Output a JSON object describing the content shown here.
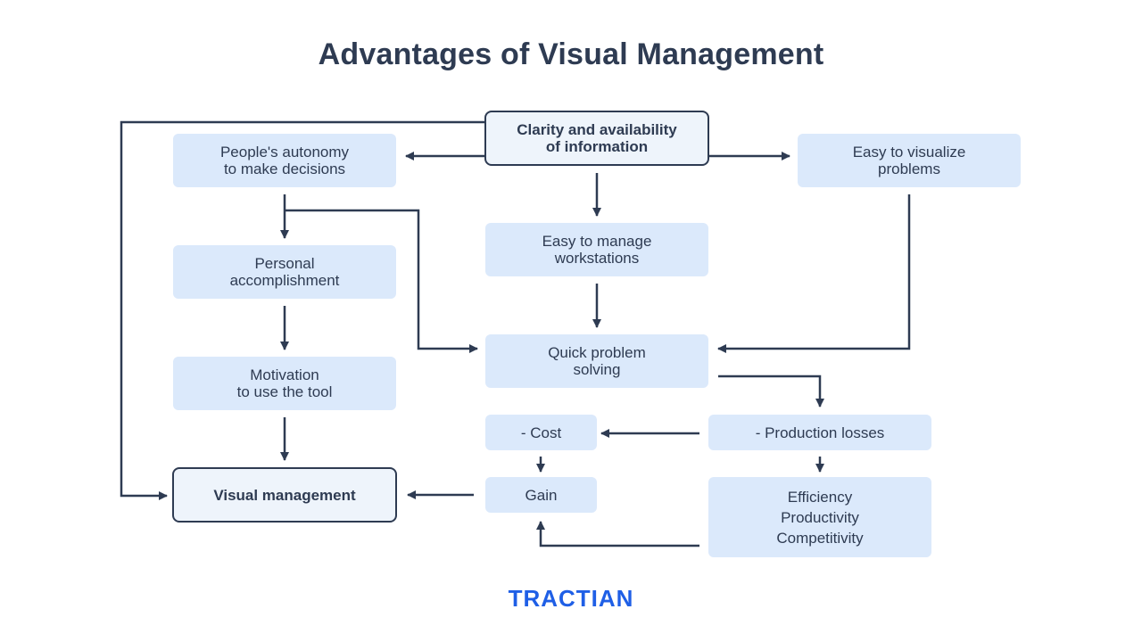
{
  "title": "Advantages of Visual Management",
  "nodes": {
    "clarity": "Clarity and availability\nof information",
    "autonomy": "People's autonomy\nto make decisions",
    "visualize": "Easy to visualize\nproblems",
    "manage": "Easy to manage\nworkstations",
    "accomplishment": "Personal\naccomplishment",
    "quick": "Quick problem\nsolving",
    "motivation": "Motivation\nto use the tool",
    "cost": "- Cost",
    "losses": "- Production losses",
    "gain": "Gain",
    "visual_mgmt": "Visual management",
    "efficiency": "Efficiency\nProductivity\nCompetitivity"
  },
  "colors": {
    "line": "#2e3b52",
    "box": "#dbe9fb",
    "key_box": "#eef4fb",
    "brand": "#1f5fe6"
  },
  "brand": "TRACTIAN"
}
